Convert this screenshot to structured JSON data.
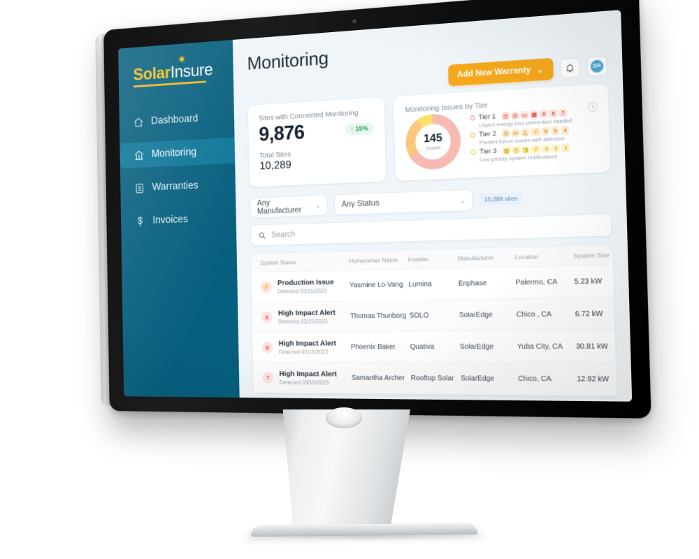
{
  "sidebar": {
    "logo": {
      "part1": "Solar",
      "part2": "Insure",
      "spark": "✷"
    },
    "items": [
      {
        "label": "Dashboard",
        "icon": "home-icon"
      },
      {
        "label": "Monitoring",
        "icon": "monitoring-icon"
      },
      {
        "label": "Warranties",
        "icon": "warranty-icon"
      },
      {
        "label": "Invoices",
        "icon": "dollar-icon"
      }
    ]
  },
  "header": {
    "title": "Monitoring",
    "add_warranty_label": "Add New Warranty",
    "chevron": "⌄",
    "avatar_initials": "DR"
  },
  "kpi": {
    "label": "Sites with Connected Monitoring",
    "value": "9,876",
    "delta": "↑ 15%",
    "sub_label": "Total Sites",
    "sub_value": "10,289"
  },
  "tier_card": {
    "title": "Monitoring Issues by Tier",
    "help": "?",
    "donut_center_value": "145",
    "donut_center_caption": "Issues",
    "tiers": [
      {
        "name": "Tier 1",
        "pills": [
          "◷",
          "◷",
          "▭",
          "▩",
          "9",
          "8",
          "7"
        ],
        "desc": "Urgent energy loss prevention needed"
      },
      {
        "name": "Tier 2",
        "pills": [
          "◷",
          "▭",
          "△",
          "⚡",
          "6",
          "5",
          "4"
        ],
        "desc": "Prevent future issues with attention"
      },
      {
        "name": "Tier 3",
        "pills": [
          "▥",
          "◷",
          "◨",
          "⚡",
          "3",
          "2",
          "1"
        ],
        "desc": "Low-priority system notifications"
      }
    ]
  },
  "filters": {
    "manufacturer": "Any Manufacturer",
    "status": "Any Status",
    "sites_chip": "10,289 sites",
    "chevron": "⌄",
    "search_placeholder": "Search",
    "search_value": ""
  },
  "table": {
    "columns": [
      "System Status",
      "Homeowner Name",
      "Installer",
      "Manufacturer",
      "Location",
      "System Size"
    ],
    "rows": [
      {
        "badge": "⚡",
        "status_title": "Production Issue",
        "status_sub": "Detected 03/15/2023",
        "homeowner": "Yasmine Lo-Vang",
        "installer": "Lumina",
        "manufacturer": "Enphase",
        "location": "Palermo, CA",
        "size": "5.23 kW"
      },
      {
        "badge": "9",
        "status_title": "High Impact Alert",
        "status_sub": "Detected 03/15/2023",
        "homeowner": "Thomas Thunborg",
        "installer": "SOLO",
        "manufacturer": "SolarEdge",
        "location": "Chico , CA",
        "size": "6.72 kW"
      },
      {
        "badge": "8",
        "status_title": "High Impact Alert",
        "status_sub": "Detected 03/15/2023",
        "homeowner": "Phoenix Baker",
        "installer": "Quativa",
        "manufacturer": "SolarEdge",
        "location": "Yuba City, CA",
        "size": "30.81 kW"
      },
      {
        "badge": "7",
        "status_title": "High Impact Alert",
        "status_sub": "Detected 03/15/2023",
        "homeowner": "Samantha Archer",
        "installer": "Rooftop Solar",
        "manufacturer": "SolarEdge",
        "location": "Chico, CA",
        "size": "12.92 kW"
      }
    ]
  },
  "colors": {
    "sidebar": "#065f7e",
    "sidebar_active": "#0d7698",
    "accent_orange": "#f5a81c",
    "logo_gold": "#f4c11d",
    "tier1": "#f8b9b0",
    "tier2": "#fbc77f",
    "tier3": "#fbe06a",
    "positive": "#29a05c"
  }
}
